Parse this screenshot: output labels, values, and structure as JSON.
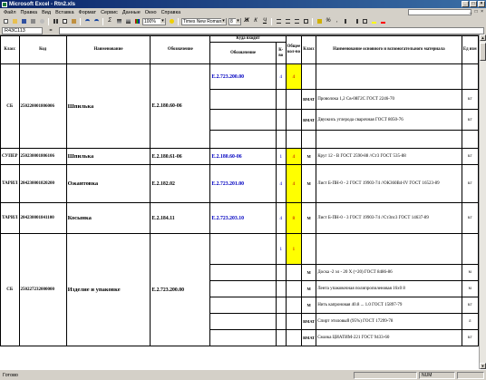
{
  "window": {
    "title": "Microsoft Excel - Rtn2.xls",
    "controls": [
      "_",
      "□",
      "×"
    ]
  },
  "menu": {
    "items": [
      "Файл",
      "Правка",
      "Вид",
      "Вставка",
      "Формат",
      "Сервис",
      "Данные",
      "Окно",
      "Справка"
    ],
    "help_placeholder": "",
    "mdi_controls": "_ □ ×"
  },
  "toolbar": {
    "zoom": "100%",
    "font": "Times New Roman",
    "size": "8"
  },
  "formula": {
    "namebox": "R43C113",
    "fx": "=",
    "value": ""
  },
  "sheet": {
    "headers": {
      "klass": "Класс",
      "code": "Код",
      "name": "Наименование",
      "designation": "Обозначение",
      "where_group": "Куда входит",
      "where_designation": "Обозначение",
      "qty": "К-во",
      "total": "Общее кол-во",
      "mat_klass": "Класс",
      "material": "Наименование основного и вспомогательного материала",
      "unit": "Ед изм"
    },
    "groups": [
      {
        "klass": "СБ",
        "code": "250220001806006",
        "name": "Шпилька",
        "designation": "Е.2.180.60-06",
        "where": "Е.2.723.200.00",
        "qty": "4",
        "total": "4",
        "total_highlight": true,
        "materials": [
          {
            "klass": "",
            "text": "",
            "unit": ""
          },
          {
            "klass": "ВМАТ",
            "text": "Проволока 1,2 Св-08Г2С   ГОСТ 2246-70",
            "unit": "кг"
          },
          {
            "klass": "ВМАТ",
            "text": "Двуокись углерода сварочная ГОСТ 8050-76",
            "unit": "кг"
          },
          {
            "klass": "",
            "text": "",
            "unit": ""
          }
        ]
      },
      {
        "klass": "СУПЕР",
        "code": "250230001806106",
        "name": "Шпилька",
        "designation": "Е.2.180.61-06",
        "where": "Е.2.180.60-06",
        "qty": "1",
        "total": "4",
        "total_highlight": true,
        "materials": [
          {
            "klass": "М",
            "text": "Круг   12 - В ГОСТ 2590-88 //Ст3 ГОСТ 535-88",
            "unit": "кг"
          }
        ]
      },
      {
        "klass": "ТАРИЛ",
        "code": "204230001820200",
        "name": "Ожантовка",
        "designation": "Е.2.182.02",
        "where": "Е.2.723.201.00",
        "qty": "4",
        "total": "4",
        "total_highlight": true,
        "materials": [
          {
            "klass": "М",
            "text": "Лист  Б-ПН-0 - 2            ГОСТ 19903-74 //ОК360В4-IV ГОСТ 16523-89",
            "unit": "кг"
          }
        ]
      },
      {
        "klass": "ТАРИЛ",
        "code": "204230001841100",
        "name": "Косынка",
        "designation": "Е.2.184.11",
        "where": "Е.2.723.203.10",
        "qty": "4",
        "total": "8",
        "total_highlight": true,
        "materials": [
          {
            "klass": "М",
            "text": "Лист  Б-ПН-0 - 3            ГОСТ 19903-74 //Ст3пс3 ГОСТ 14637-89",
            "unit": "кг"
          }
        ]
      },
      {
        "klass": "СБ",
        "code": "250227232000000",
        "name": "Изделие и упаковке",
        "designation": "Е.2.723.200.00",
        "where": "",
        "qty": "1",
        "total": "1",
        "total_highlight": true,
        "materials": [
          {
            "klass": "",
            "text": "",
            "unit": ""
          },
          {
            "klass": "М",
            "text": "Доска  -2 эл - 20 Х (=20)  ГОСТ 8486-86",
            "unit": "м"
          },
          {
            "klass": "М",
            "text": "Лента упаковочная полипропиленовая 16х0 8",
            "unit": "м"
          },
          {
            "klass": "М",
            "text": "Нить капроновая  40.8 ... 1.0     ГОСТ  15897-79",
            "unit": "кг"
          },
          {
            "klass": "ВМАТ",
            "text": "Спирт этиловый (95%) ГОСТ 17299-78",
            "unit": "л"
          },
          {
            "klass": "ВМАТ",
            "text": "Смазка ЦИАТИМ-221 ГОСТ 9433-60",
            "unit": "кг"
          }
        ]
      }
    ]
  },
  "status": {
    "left": "Готово",
    "num": "NUM"
  }
}
